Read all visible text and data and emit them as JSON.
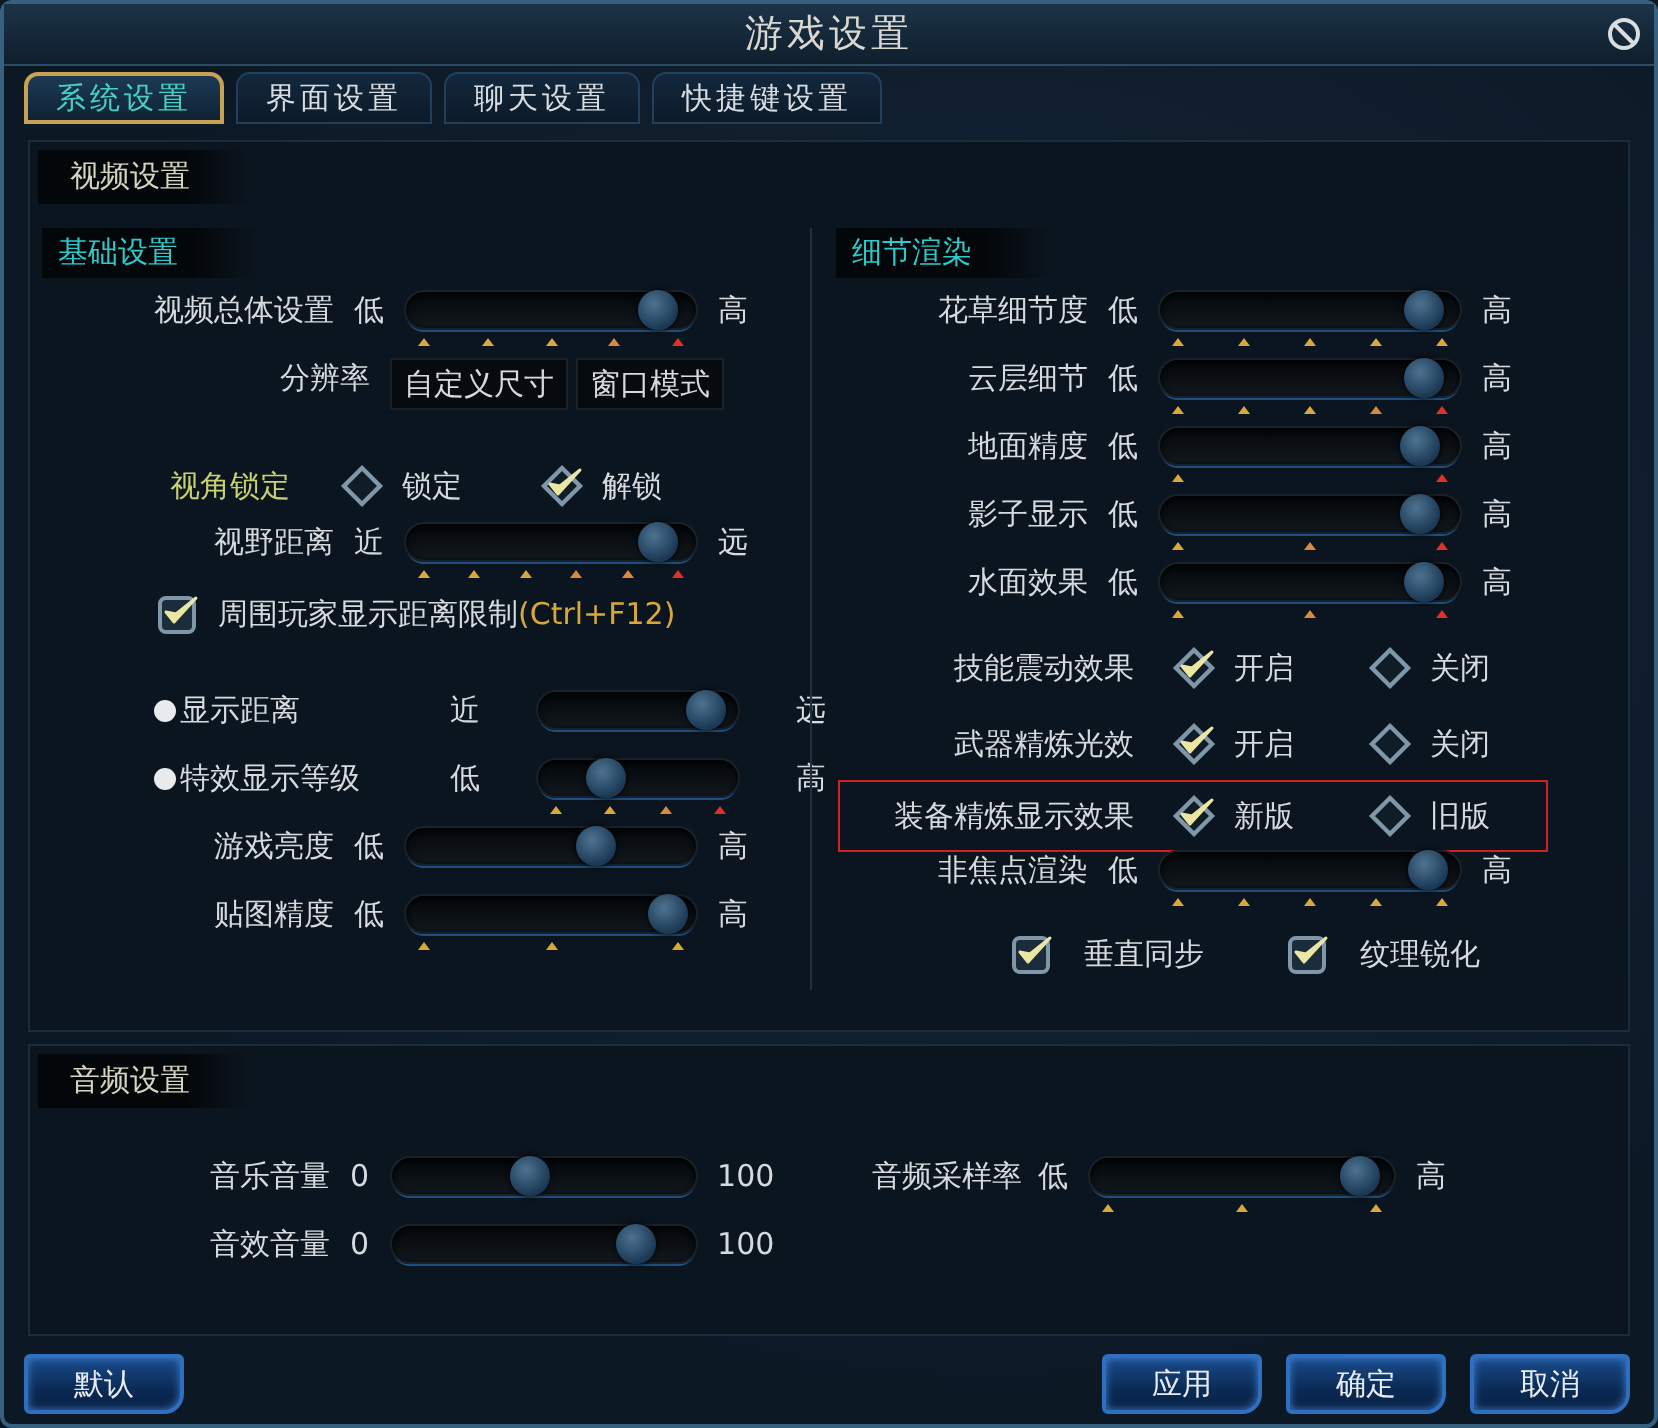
{
  "window": {
    "title": "游戏设置"
  },
  "tabs": [
    {
      "label": "系统设置",
      "selected": true
    },
    {
      "label": "界面设置",
      "selected": false
    },
    {
      "label": "聊天设置",
      "selected": false
    },
    {
      "label": "快捷键设置",
      "selected": false
    }
  ],
  "video": {
    "title": "视频设置",
    "basic": {
      "title": "基础设置",
      "rows": [
        {
          "kind": "slider",
          "label": "视频总体设置",
          "min": "低",
          "max": "高",
          "level": 0.93,
          "ticks": [
            {
              "color": "#d8a83a"
            },
            {
              "color": "#d8a83a"
            },
            {
              "color": "#d8a83a"
            },
            {
              "color": "#d88a3a"
            },
            {
              "color": "#e0302a"
            }
          ]
        },
        {
          "kind": "selects",
          "label": "分辨率",
          "values": [
            "自定义尺寸",
            "窗口模式"
          ]
        },
        {
          "kind": "radio",
          "label": "视角锁定",
          "color": "#c8d070",
          "options": [
            {
              "label": "锁定",
              "selected": false
            },
            {
              "label": "解锁",
              "selected": true
            }
          ]
        },
        {
          "kind": "slider",
          "label": "视野距离",
          "min": "近",
          "max": "远",
          "level": 0.93,
          "ticks": [
            {
              "color": "#d8a83a"
            },
            {
              "color": "#d8a83a"
            },
            {
              "color": "#d8a83a"
            },
            {
              "color": "#d88a3a"
            },
            {
              "color": "#d88a3a"
            },
            {
              "color": "#e0302a"
            }
          ]
        },
        {
          "kind": "check",
          "label": "周围玩家显示距离限制",
          "hotkey": "(Ctrl+F12)",
          "checked": true
        },
        {
          "kind": "slider",
          "bullet": true,
          "label": "显示距离",
          "min": "近",
          "max": "远",
          "level": 0.93
        },
        {
          "kind": "slider",
          "bullet": true,
          "label": "特效显示等级",
          "min": "低",
          "max": "高",
          "level": 0.3,
          "ticks": [
            {
              "color": "#d8a83a"
            },
            {
              "color": "#d8a83a"
            },
            {
              "color": "#d88a3a"
            },
            {
              "color": "#e0302a"
            }
          ]
        },
        {
          "kind": "slider",
          "label": "游戏亮度",
          "min": "低",
          "max": "高",
          "level": 0.68
        },
        {
          "kind": "slider",
          "label": "贴图精度",
          "min": "低",
          "max": "高",
          "level": 0.97,
          "ticks": [
            {
              "color": "#d8a83a"
            },
            {
              "color": "#d8a83a"
            },
            {
              "color": "#d8a83a"
            }
          ]
        }
      ]
    },
    "detail": {
      "title": "细节渲染",
      "rows": [
        {
          "kind": "slider",
          "label": "花草细节度",
          "min": "低",
          "max": "高",
          "level": 0.94,
          "ticks": [
            {
              "color": "#d8a83a"
            },
            {
              "color": "#d8a83a"
            },
            {
              "color": "#d8a83a"
            },
            {
              "color": "#d8a83a"
            },
            {
              "color": "#d8a83a"
            }
          ]
        },
        {
          "kind": "slider",
          "label": "云层细节",
          "min": "低",
          "max": "高",
          "level": 0.94,
          "ticks": [
            {
              "color": "#d8a83a"
            },
            {
              "color": "#d8a83a"
            },
            {
              "color": "#d8a83a"
            },
            {
              "color": "#d88a3a"
            },
            {
              "color": "#e0302a"
            }
          ]
        },
        {
          "kind": "slider",
          "label": "地面精度",
          "min": "低",
          "max": "高",
          "level": 0.92,
          "ticks": [
            {
              "color": "#d8a83a"
            },
            {
              "color": "#e0302a"
            }
          ]
        },
        {
          "kind": "slider",
          "label": "影子显示",
          "min": "低",
          "max": "高",
          "level": 0.92,
          "ticks": [
            {
              "color": "#d8a83a"
            },
            {
              "color": "#d88a3a"
            },
            {
              "color": "#e0302a"
            }
          ]
        },
        {
          "kind": "slider",
          "label": "水面效果",
          "min": "低",
          "max": "高",
          "level": 0.94,
          "ticks": [
            {
              "color": "#d8a83a"
            },
            {
              "color": "#d88a3a"
            },
            {
              "color": "#e0302a"
            }
          ]
        },
        {
          "kind": "radio",
          "label": "技能震动效果",
          "options": [
            {
              "label": "开启",
              "selected": true
            },
            {
              "label": "关闭",
              "selected": false
            }
          ]
        },
        {
          "kind": "radio",
          "label": "武器精炼光效",
          "options": [
            {
              "label": "开启",
              "selected": true
            },
            {
              "label": "关闭",
              "selected": false
            }
          ]
        },
        {
          "kind": "radio",
          "label": "装备精炼显示效果",
          "highlighted": true,
          "options": [
            {
              "label": "新版",
              "selected": true
            },
            {
              "label": "旧版",
              "selected": false
            }
          ]
        },
        {
          "kind": "slider",
          "label": "非焦点渲染",
          "min": "低",
          "max": "高",
          "level": 0.95,
          "ticks": [
            {
              "color": "#d8a83a"
            },
            {
              "color": "#d8a83a"
            },
            {
              "color": "#d8a83a"
            },
            {
              "color": "#d8a83a"
            },
            {
              "color": "#d8a83a"
            }
          ]
        },
        {
          "kind": "checks",
          "items": [
            {
              "label": "垂直同步",
              "checked": true
            },
            {
              "label": "纹理锐化",
              "checked": true
            }
          ]
        }
      ]
    }
  },
  "audio": {
    "title": "音频设置",
    "left": [
      {
        "label": "音乐音量",
        "min": "0",
        "max": "100",
        "level": 0.45
      },
      {
        "label": "音效音量",
        "min": "0",
        "max": "100",
        "level": 0.85
      }
    ],
    "right": [
      {
        "label": "音频采样率",
        "min": "低",
        "max": "高",
        "level": 0.95,
        "ticks": [
          {
            "color": "#d8a83a"
          },
          {
            "color": "#d8a83a"
          },
          {
            "color": "#d8a83a"
          }
        ]
      }
    ]
  },
  "footer": {
    "left": [
      "默认"
    ],
    "right": [
      "应用",
      "确定",
      "取消"
    ]
  }
}
